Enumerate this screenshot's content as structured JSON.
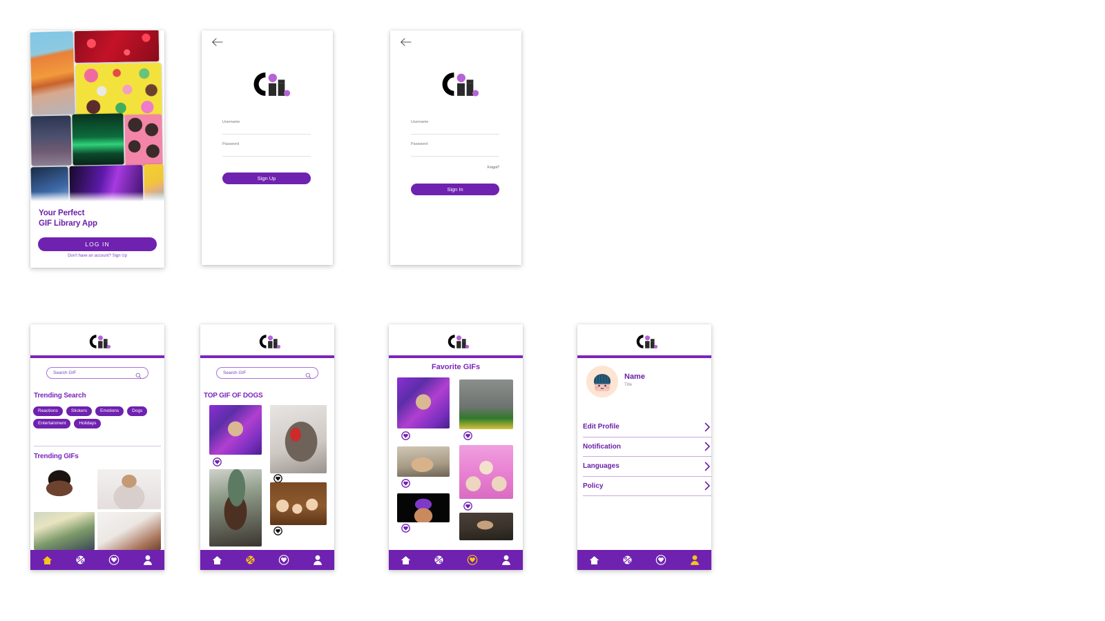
{
  "brand": {
    "logo_name": "gif-logo",
    "purple": "#6f21b0",
    "purple_dark": "#6a1fa8",
    "purple_rule": "#7a25bd",
    "accent_dot": "#b663d8",
    "nav_active": "#f5c518"
  },
  "screens": {
    "onboarding": {
      "name": "onboarding-screen",
      "headline_line1": "Your Perfect",
      "headline_line2": "GIF Library App",
      "login_button": "LOG IN",
      "signup_prompt": "Don't have an account? Sign Up",
      "collage_tiles": [
        {
          "name": "tile-vw-bus"
        },
        {
          "name": "tile-red-neon-pattern"
        },
        {
          "name": "tile-yellow-candy"
        },
        {
          "name": "tile-city-street"
        },
        {
          "name": "tile-aurora"
        },
        {
          "name": "tile-pink-donuts"
        },
        {
          "name": "tile-blue-lights"
        },
        {
          "name": "tile-purple-tunnel"
        },
        {
          "name": "tile-peace-hand"
        }
      ]
    },
    "signup": {
      "name": "sign-up-screen",
      "back_icon": "back-arrow-icon",
      "username_label": "Username",
      "password_label": "Password",
      "username_value": "",
      "password_value": "",
      "submit_label": "Sign Up"
    },
    "signin": {
      "name": "sign-in-screen",
      "back_icon": "back-arrow-icon",
      "username_label": "Username",
      "password_label": "Password",
      "username_value": "",
      "password_value": "",
      "forgot_label": "Forgot?",
      "submit_label": "Sign In"
    },
    "home": {
      "name": "home-screen",
      "search_placeholder": "Search GIF",
      "trending_search_title": "Trending Search",
      "chips": [
        "Reactions",
        "Stickers",
        "Emotions",
        "Dogs",
        "Entertainment",
        "Holidays"
      ],
      "trending_gifs_title": "Trending GIFs",
      "gifs": [
        {
          "name": "gif-drake-reaction"
        },
        {
          "name": "gif-long-hair-guy"
        },
        {
          "name": "gif-grocery-scene"
        },
        {
          "name": "gif-bed-scene"
        }
      ]
    },
    "discover": {
      "name": "discover-screen",
      "search_placeholder": "Search GIF",
      "section_title": "TOP GIF OF DOGS",
      "gifs": [
        {
          "name": "gif-flying-chihuahua",
          "liked": true
        },
        {
          "name": "gif-bulldog-toy",
          "liked": true
        },
        {
          "name": "gif-dog-beanie",
          "liked": false
        },
        {
          "name": "gif-puppy-crowd",
          "liked": false
        }
      ]
    },
    "favorites": {
      "name": "favorites-screen",
      "title": "Favorite GIFs",
      "gifs": [
        {
          "name": "gif-flying-chihuahua",
          "liked": true
        },
        {
          "name": "gif-i-get-money-dog",
          "liked": true
        },
        {
          "name": "gif-shiba-boop",
          "liked": true
        },
        {
          "name": "gif-pink-puppy-collage",
          "liked": true
        },
        {
          "name": "gif-purple-hair-character",
          "liked": true
        },
        {
          "name": "gif-glass-case-of-emotion",
          "liked": false
        }
      ]
    },
    "profile": {
      "name": "profile-screen",
      "avatar_name": "user-avatar",
      "user_name": "Name",
      "user_title": "Title",
      "menu": [
        {
          "label": "Edit Profile",
          "name": "menu-edit-profile"
        },
        {
          "label": "Notification",
          "name": "menu-notification"
        },
        {
          "label": "Languages",
          "name": "menu-languages"
        },
        {
          "label": "Policy",
          "name": "menu-policy"
        }
      ]
    }
  },
  "nav": {
    "items": [
      {
        "icon": "home-icon",
        "name": "nav-home"
      },
      {
        "icon": "compass-icon",
        "name": "nav-discover"
      },
      {
        "icon": "heart-icon",
        "name": "nav-favorites"
      },
      {
        "icon": "person-icon",
        "name": "nav-profile"
      }
    ]
  }
}
